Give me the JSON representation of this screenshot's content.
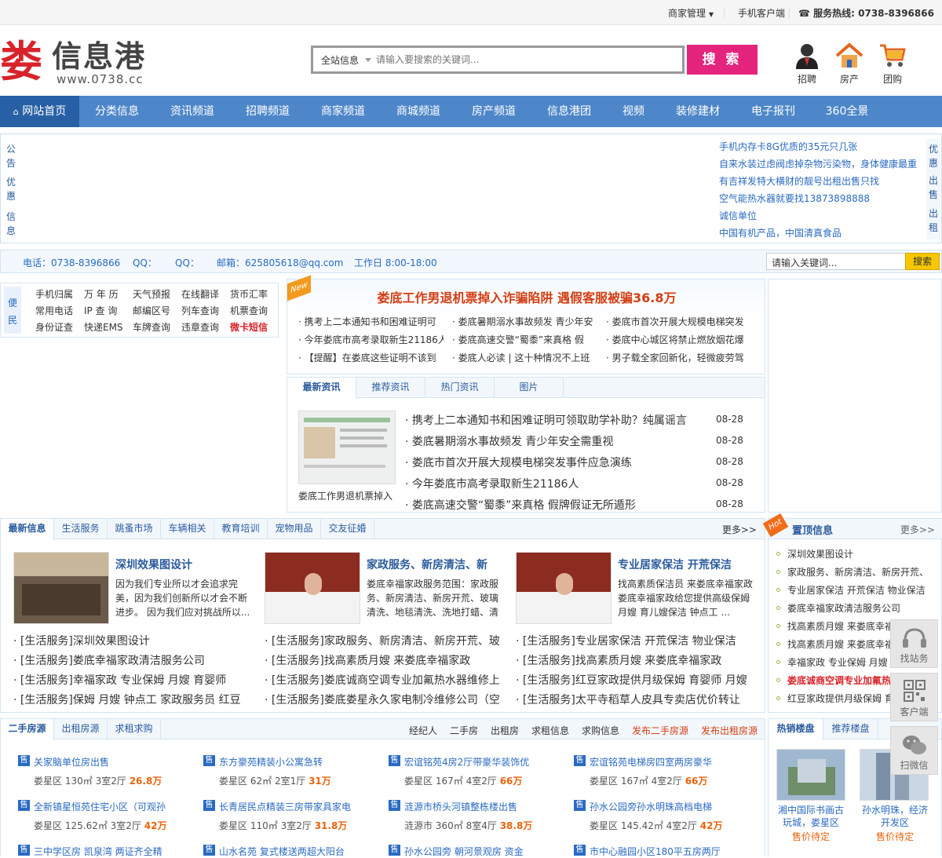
{
  "topbar": {
    "merchant": "商家管理",
    "mobile": "手机客户端",
    "hotline": "服务热线: 0738-8396866"
  },
  "logo": {
    "mark": "娄",
    "name": "信息港",
    "url": "www.0738.cc"
  },
  "search": {
    "scope": "全站信息",
    "placeholder": "请输入要搜索的关键词...",
    "button": "搜 索"
  },
  "quick_icons": [
    {
      "label": "招聘",
      "icon": "person-icon"
    },
    {
      "label": "房产",
      "icon": "house-icon"
    },
    {
      "label": "团购",
      "icon": "cart-icon"
    }
  ],
  "nav": [
    "网站首页",
    "分类信息",
    "资讯频道",
    "招聘频道",
    "商家频道",
    "商城频道",
    "房产频道",
    "信息港团",
    "视频",
    "装修建材",
    "电子报刊",
    "360全景"
  ],
  "notice": {
    "left_tabs": [
      "公告",
      "优惠",
      "信息"
    ],
    "right_tabs": [
      "优惠",
      "出售",
      "出租"
    ],
    "links": [
      "手机内存卡8G优质的35元只几张",
      "自来水装过虑阀虑掉杂物污染物，身体健康最重",
      "有吉祥发特大横财的靓号出租出售只找",
      "空气能热水器就要找13873898888",
      "诚信单位",
      "中国有机产品，中国清真食品"
    ]
  },
  "contact": {
    "phone": "电话：0738-8396866",
    "qq1": "QQ：",
    "qq2": "QQ：",
    "email": "邮箱：625805618@qq.com",
    "hours": "工作日 8:00-18:00",
    "kw_placeholder": "请输入关键词...",
    "kw_button": "搜索"
  },
  "convenience": {
    "tag": "便民",
    "rows": [
      [
        "手机归属",
        "万 年 历",
        "天气预报",
        "在线翻译",
        "货币汇率"
      ],
      [
        "常用电话",
        "IP 查 询",
        "邮编区号",
        "列车查询",
        "机票查询"
      ],
      [
        "身份证查",
        "快递EMS",
        "车牌查询",
        "违章查询",
        "微卡短信"
      ]
    ]
  },
  "headline": {
    "badge": "New",
    "title": "娄底工作男退机票掉入诈骗陷阱 遇假客服被骗36.8万",
    "links": [
      [
        "携考上二本通知书和困难证明可",
        "娄底暑期溺水事故频发 青少年安",
        "娄底市首次开展大规模电梯突发"
      ],
      [
        "今年娄底市高考录取新生21186人",
        "娄底高速交警“蜀黍”来真格 假",
        "娄底中心城区将禁止燃放烟花爆"
      ],
      [
        "【提醒】在娄底这些证明不该到",
        "娄底人必读 | 这十种情况不上班",
        "男子载全家回新化，轻微疲劳驾"
      ]
    ]
  },
  "news": {
    "tabs": [
      "最新资讯",
      "推荐资讯",
      "热门资讯",
      "图片"
    ],
    "thumb_caption": "娄底工作男退机票掉入",
    "items": [
      {
        "title": "携考上二本通知书和困难证明可领取助学补助？纯属谣言",
        "date": "08-28"
      },
      {
        "title": "娄底暑期溺水事故频发 青少年安全需重视",
        "date": "08-28"
      },
      {
        "title": "娄底市首次开展大规模电梯突发事件应急演练",
        "date": "08-28"
      },
      {
        "title": "今年娄底市高考录取新生21186人",
        "date": "08-28"
      },
      {
        "title": "娄底高速交警“蜀黍”来真格 假牌假证无所遁形",
        "date": "08-28"
      }
    ]
  },
  "classified": {
    "tabs": [
      "最新信息",
      "生活服务",
      "跳蚤市场",
      "车辆相关",
      "教育培训",
      "宠物用品",
      "交友征婚"
    ],
    "more": "更多>>",
    "cards": [
      {
        "title": "深圳效果图设计",
        "desc": "因为我们专业所以才会追求完美，因为我们创新所以才会不断进步。 因为我们应对挑战所以..."
      },
      {
        "title": "家政服务、新房清洁、新",
        "desc": "娄底幸福家政服务范围：家政服务、新房清洁、新房开荒、玻璃清洗、地毯清洗、洗地打蜡、清"
      },
      {
        "title": "专业居家保洁 开荒保洁",
        "desc": "找高素质保洁员 来娄底幸福家政 娄底幸福家政给您提供高级保姆 月嫂 育儿嫂保洁 钟点工 ..."
      }
    ],
    "cols": [
      [
        "[生活服务]深圳效果图设计",
        "[生活服务]娄底幸福家政清洁服务公司",
        "[生活服务]幸福家政 专业保姆 月嫂 育婴师",
        "[生活服务]保姆 月嫂 钟点工 家政服务员 红豆"
      ],
      [
        "[生活服务]家政服务、新房清洁、新房开荒、玻",
        "[生活服务]找高素质月嫂 来娄底幸福家政",
        "[生活服务]娄底诚商空调专业加氟热水器维修上",
        "[生活服务]娄底娄星永久家电制冷维修公司（空"
      ],
      [
        "[生活服务]专业居家保洁 开荒保洁 物业保洁",
        "[生活服务]找高素质月嫂 来娄底幸福家政",
        "[生活服务]红豆家政提供月级保姆 育婴师 月嫂",
        "[生活服务]太平寺稻草人皮具专卖店优价转让"
      ]
    ]
  },
  "topinfo": {
    "badge": "Hot",
    "title": "置顶信息",
    "more": "更多>>",
    "items": [
      "深圳效果图设计",
      "家政服务、新房清洁、新房开荒、",
      "专业居家保洁 开荒保洁 物业保洁",
      "娄底幸福家政清洁服务公司",
      "找高素质月嫂 来娄底幸福家政",
      "找高素质月嫂 来娄底幸福家政",
      "幸福家政 专业保姆 月嫂 育婴师",
      "娄底诚商空调专业加氟热水器维修",
      "红豆家政提供月级保姆 育婴师 月嫂"
    ]
  },
  "house": {
    "tabs": [
      "二手房源",
      "出租房源",
      "求租求购"
    ],
    "links": [
      "经纪人",
      "二手房",
      "出租房",
      "求租信息",
      "求购信息",
      "发布二手房源",
      "发布出租房源"
    ],
    "badge": "售",
    "items": [
      {
        "title": "关家脑单位房出售",
        "area": "娄星区",
        "size": "130㎡",
        "rooms": "3室2厅",
        "price": "26.8万"
      },
      {
        "title": "东方豪苑精装小公寓急转",
        "area": "娄星区",
        "size": "62㎡",
        "rooms": "2室1厅",
        "price": "31万"
      },
      {
        "title": "宏谊铭苑4房2厅带豪华装饰优",
        "area": "娄星区",
        "size": "167㎡",
        "rooms": "4室2厅",
        "price": "66万"
      },
      {
        "title": "宏谊铭苑电梯房四室两房豪华",
        "area": "娄星区",
        "size": "167㎡",
        "rooms": "4室2厅",
        "price": "66万"
      },
      {
        "title": "全新镇星恒苑住宅小区（可观孙",
        "area": "娄星区",
        "size": "125.62㎡",
        "rooms": "3室2厅",
        "price": "42万"
      },
      {
        "title": "长青居民点精装三房带家具家电",
        "area": "娄星区",
        "size": "110㎡",
        "rooms": "3室2厅",
        "price": "31.8万"
      },
      {
        "title": "涟源市桥头河镇整栋楼出售",
        "area": "涟源市",
        "size": "360㎡",
        "rooms": "8室4厅",
        "price": "38.8万"
      },
      {
        "title": "孙水公园旁孙水明珠高档电梯",
        "area": "娄星区",
        "size": "145.42㎡",
        "rooms": "4室2厅",
        "price": "42万"
      },
      {
        "title": "三中学区房 凯泉湾 两证齐全精",
        "area": "",
        "size": "",
        "rooms": "",
        "price": ""
      },
      {
        "title": "山水名苑 复式楼送两超大阳台",
        "area": "",
        "size": "",
        "rooms": "",
        "price": ""
      },
      {
        "title": "孙水公园旁 朝河景观房 资金",
        "area": "",
        "size": "",
        "rooms": "",
        "price": ""
      },
      {
        "title": "市中心融园小区180平五房两厅",
        "area": "",
        "size": "",
        "rooms": "",
        "price": ""
      }
    ]
  },
  "hot": {
    "tabs": [
      "热销楼盘",
      "推荐楼盘"
    ],
    "items": [
      {
        "name": "湘中国际书画古玩城，娄星区",
        "status": "售价待定"
      },
      {
        "name": "孙水明珠，经济开发区",
        "status": "售价待定"
      }
    ]
  },
  "float": [
    "找站务",
    "客户端",
    "扫微信"
  ],
  "colors": {
    "nav": "#4e87c9",
    "nav_active": "#2760a5",
    "search_btn": "#e4237d",
    "headline": "#d43d12",
    "link": "#2a6ac2",
    "price": "#e8640c"
  }
}
